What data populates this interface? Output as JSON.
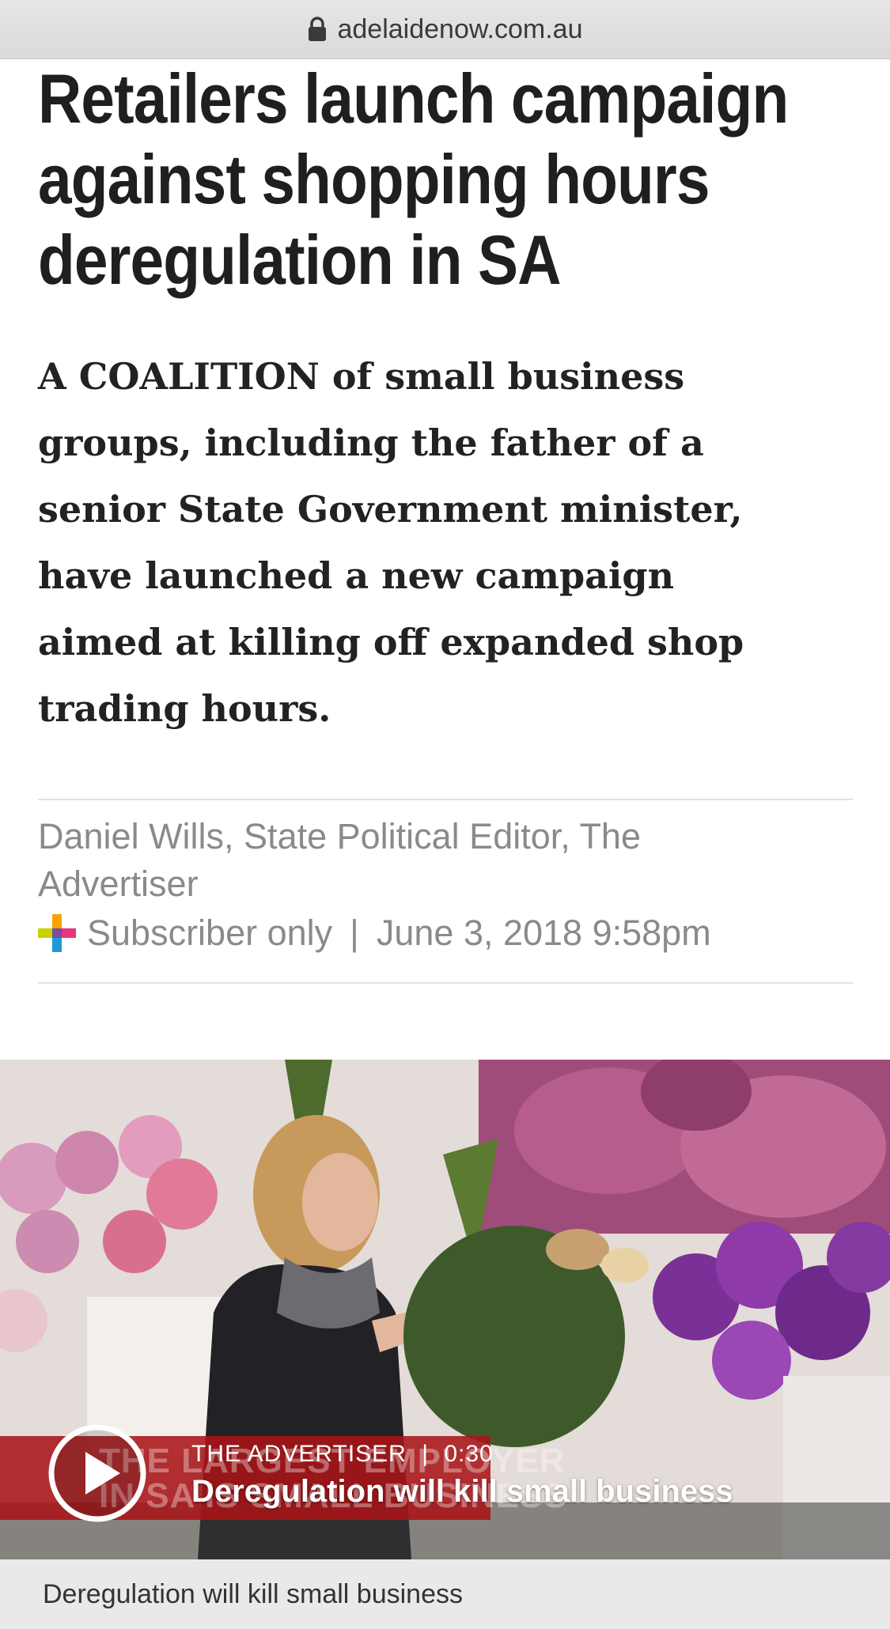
{
  "browser": {
    "url": "adelaidenow.com.au",
    "icons": {
      "lock": "lock-icon"
    }
  },
  "article": {
    "headline_lines": [
      "Retailers launch campaign",
      "against shopping hours",
      "deregulation in SA"
    ],
    "standfirst_lines": [
      "A COALITION of small business",
      "groups, including the father of a",
      "senior State Government minister,",
      "have launched a new campaign",
      "aimed at killing off expanded shop",
      "trading hours."
    ],
    "byline_lines": [
      "Daniel Wills, State Political Editor, The",
      "Advertiser"
    ],
    "subscriber_label": "Subscriber only",
    "separator": "|",
    "date": "June 3, 2018 9:58pm"
  },
  "video": {
    "source": "THE ADVERTISER",
    "separator": "|",
    "duration": "0:30",
    "title": "Deregulation will kill small business",
    "lower_third_lines": [
      "THE LARGEST EMPLOYER",
      "IN SA IS SMALL BUSINESS"
    ],
    "caption": "Deregulation will kill small business",
    "icons": {
      "play": "play-icon"
    }
  },
  "colors": {
    "headline": "#1f1f1f",
    "meta_grey": "#8a8a8a",
    "lower_third_red": "#a81418",
    "caption_bg": "#e9e9e9"
  }
}
